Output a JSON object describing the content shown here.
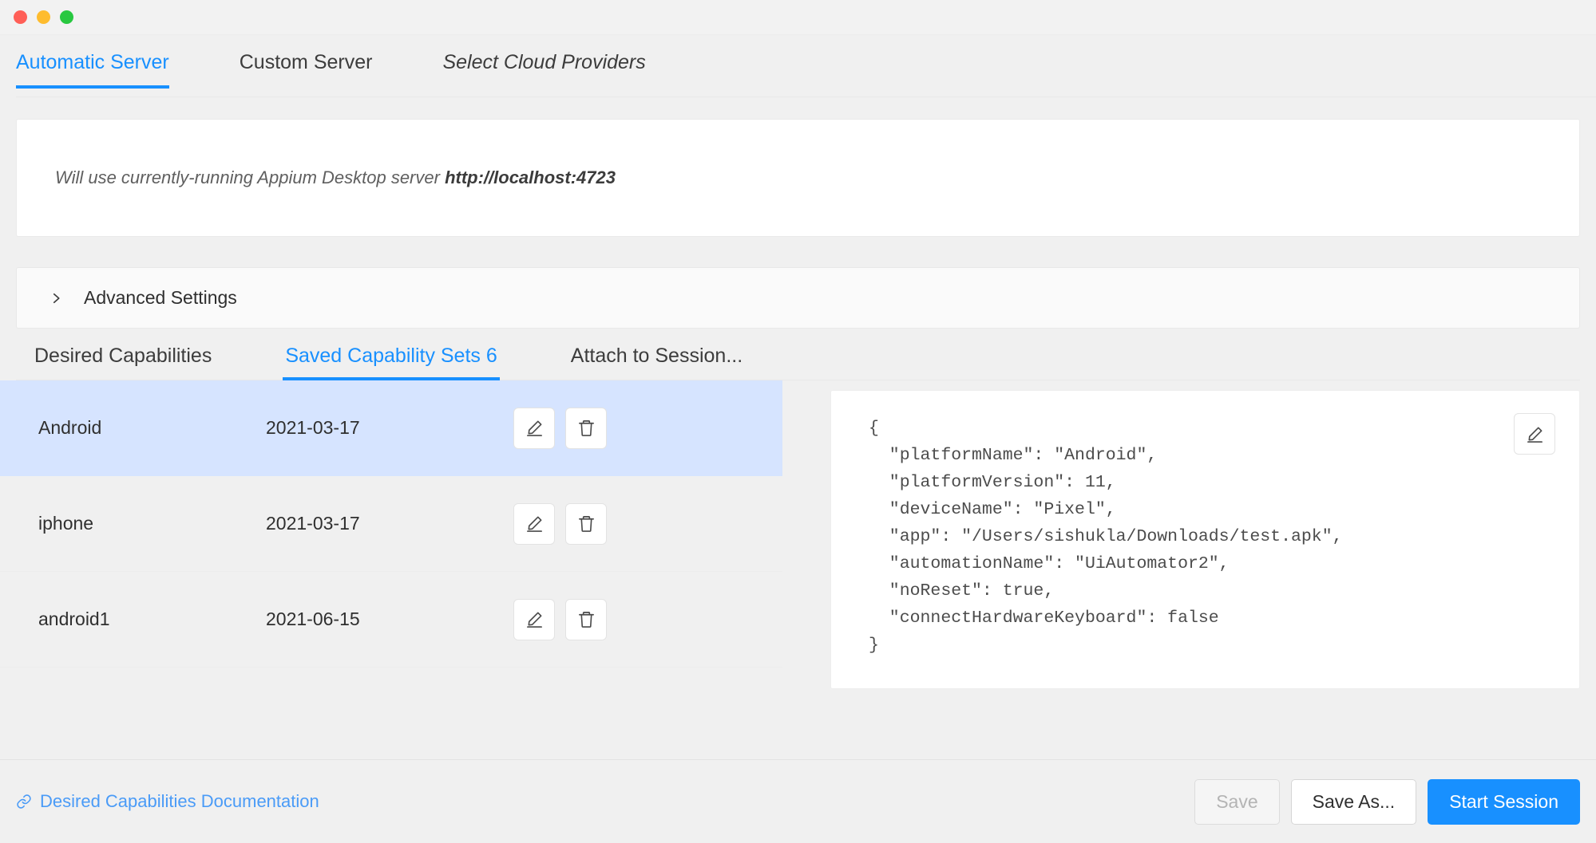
{
  "window": {
    "traffic_lights": [
      {
        "name": "close",
        "color": "#ff5f57"
      },
      {
        "name": "minimize",
        "color": "#febc2e"
      },
      {
        "name": "maximize",
        "color": "#28c840"
      }
    ]
  },
  "theme": {
    "accent": "#1890ff",
    "link": "#4a9bf7",
    "selected_row_bg": "#d6e4ff",
    "page_bg": "#f0f0f0",
    "panel_bg": "#ffffff"
  },
  "server_tabs": [
    {
      "label": "Automatic Server",
      "active": true,
      "italic": false
    },
    {
      "label": "Custom Server",
      "active": false,
      "italic": false
    },
    {
      "label": "Select Cloud Providers",
      "active": false,
      "italic": true
    }
  ],
  "banner": {
    "prefix": "Will use currently-running Appium Desktop server ",
    "server_url": "http://localhost:4723"
  },
  "advanced": {
    "label": "Advanced Settings",
    "chevron_icon": "chevron-right-icon",
    "expanded": false
  },
  "capability_tabs": [
    {
      "label": "Desired Capabilities",
      "active": false
    },
    {
      "label": "Saved Capability Sets 6",
      "active": true
    },
    {
      "label": "Attach to Session...",
      "active": false
    }
  ],
  "saved_sets": {
    "rows": [
      {
        "name": "Android",
        "date": "2021-03-17",
        "selected": true
      },
      {
        "name": "iphone",
        "date": "2021-03-17",
        "selected": false
      },
      {
        "name": "android1",
        "date": "2021-06-15",
        "selected": false
      }
    ],
    "edit_icon": "pencil-icon",
    "delete_icon": "trash-icon"
  },
  "capabilities_json": {
    "edit_icon": "pencil-icon",
    "text": "{\n  \"platformName\": \"Android\",\n  \"platformVersion\": 11,\n  \"deviceName\": \"Pixel\",\n  \"app\": \"/Users/sishukla/Downloads/test.apk\",\n  \"automationName\": \"UiAutomator2\",\n  \"noReset\": true,\n  \"connectHardwareKeyboard\": false\n}"
  },
  "footer": {
    "doc_link_label": "Desired Capabilities Documentation",
    "doc_link_icon": "link-icon",
    "save_label": "Save",
    "save_disabled": true,
    "save_as_label": "Save As...",
    "start_session_label": "Start Session"
  }
}
